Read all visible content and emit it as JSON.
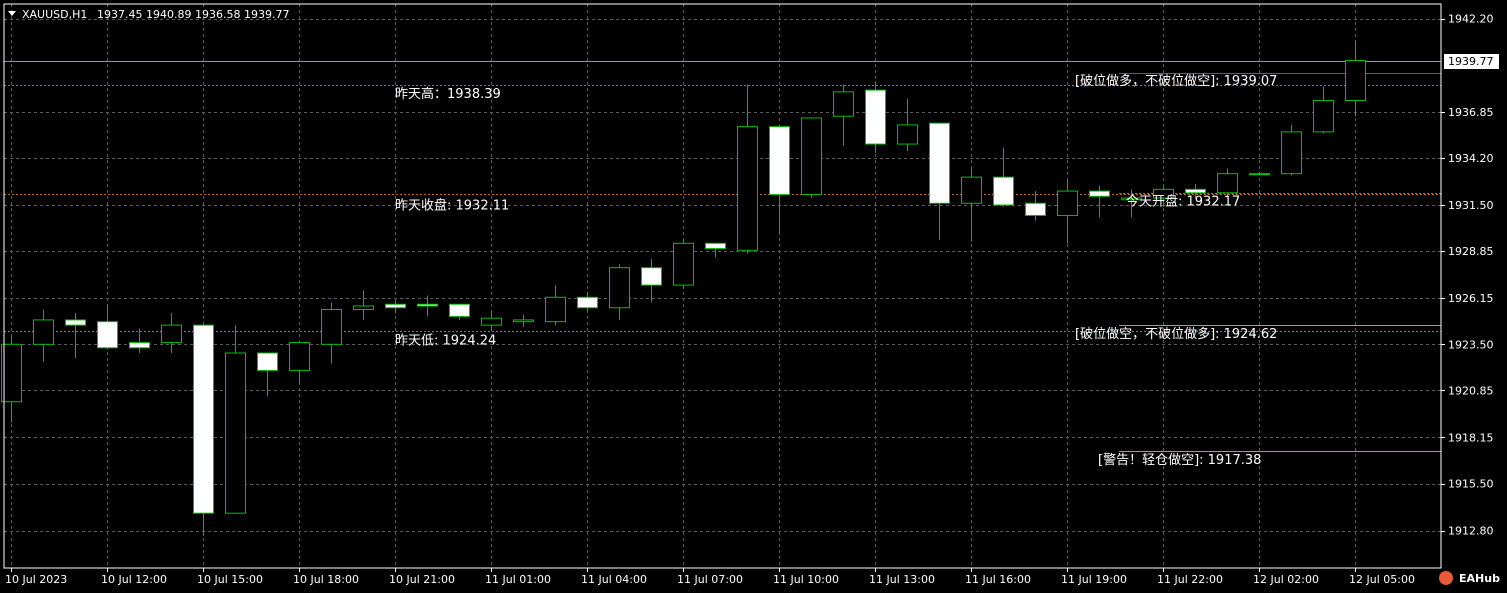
{
  "header": {
    "symbol": "XAUUSD,H1",
    "ohlc": "1937.45 1940.89 1936.58 1939.77"
  },
  "brand": {
    "label": "EAHub"
  },
  "colors": {
    "background": "#000000",
    "grid": "#5a5a5a",
    "candle_outline": "#00c000",
    "bull_body": "#000000",
    "bear_body": "#ffffff",
    "bid_line": "#8899aa",
    "level_red": "#c83232",
    "level_blue": "#8899cc",
    "level_dotted": "#b07030"
  },
  "chart_data": {
    "type": "candlestick",
    "timeframe": "H1",
    "ylim": [
      1911.8,
      1942.7
    ],
    "y_ticks": [
      "1942.20",
      "1939.77",
      "1936.85",
      "1934.20",
      "1931.50",
      "1928.85",
      "1926.15",
      "1923.50",
      "1920.85",
      "1918.15",
      "1915.50",
      "1912.80"
    ],
    "y_tick_values": [
      1942.2,
      1939.77,
      1936.85,
      1934.2,
      1931.5,
      1928.85,
      1926.15,
      1923.5,
      1920.85,
      1918.15,
      1915.5,
      1912.8
    ],
    "current_price": 1939.77,
    "x_ticks": [
      {
        "label": "10 Jul 2023",
        "index": 0
      },
      {
        "label": "10 Jul 12:00",
        "index": 3
      },
      {
        "label": "10 Jul 15:00",
        "index": 6
      },
      {
        "label": "10 Jul 18:00",
        "index": 9
      },
      {
        "label": "10 Jul 21:00",
        "index": 12
      },
      {
        "label": "11 Jul 01:00",
        "index": 15
      },
      {
        "label": "11 Jul 04:00",
        "index": 18
      },
      {
        "label": "11 Jul 07:00",
        "index": 21
      },
      {
        "label": "11 Jul 10:00",
        "index": 24
      },
      {
        "label": "11 Jul 13:00",
        "index": 27
      },
      {
        "label": "11 Jul 16:00",
        "index": 30
      },
      {
        "label": "11 Jul 19:00",
        "index": 33
      },
      {
        "label": "11 Jul 22:00",
        "index": 36
      },
      {
        "label": "12 Jul 02:00",
        "index": 39
      },
      {
        "label": "12 Jul 05:00",
        "index": 42
      }
    ],
    "candles": [
      {
        "o": 1920.2,
        "h": 1924.0,
        "l": 1919.0,
        "c": 1923.5
      },
      {
        "o": 1923.5,
        "h": 1925.5,
        "l": 1922.5,
        "c": 1924.9
      },
      {
        "o": 1924.9,
        "h": 1925.3,
        "l": 1922.7,
        "c": 1924.6
      },
      {
        "o": 1924.8,
        "h": 1925.8,
        "l": 1923.2,
        "c": 1923.3
      },
      {
        "o": 1923.6,
        "h": 1924.4,
        "l": 1923.0,
        "c": 1923.3
      },
      {
        "o": 1923.6,
        "h": 1925.3,
        "l": 1923.0,
        "c": 1924.6
      },
      {
        "o": 1924.6,
        "h": 1924.6,
        "l": 1912.5,
        "c": 1913.8
      },
      {
        "o": 1913.8,
        "h": 1924.6,
        "l": 1913.8,
        "c": 1923.0
      },
      {
        "o": 1923.0,
        "h": 1923.0,
        "l": 1920.5,
        "c": 1922.0
      },
      {
        "o": 1922.0,
        "h": 1923.6,
        "l": 1921.3,
        "c": 1923.6
      },
      {
        "o": 1923.5,
        "h": 1925.9,
        "l": 1922.4,
        "c": 1925.5
      },
      {
        "o": 1925.5,
        "h": 1926.6,
        "l": 1924.9,
        "c": 1925.7
      },
      {
        "o": 1925.8,
        "h": 1926.0,
        "l": 1925.3,
        "c": 1925.6
      },
      {
        "o": 1925.8,
        "h": 1926.3,
        "l": 1925.1,
        "c": 1925.7
      },
      {
        "o": 1925.8,
        "h": 1925.8,
        "l": 1924.9,
        "c": 1925.1
      },
      {
        "o": 1924.6,
        "h": 1925.4,
        "l": 1924.3,
        "c": 1925.0
      },
      {
        "o": 1924.8,
        "h": 1925.2,
        "l": 1924.5,
        "c": 1924.9
      },
      {
        "o": 1924.8,
        "h": 1926.9,
        "l": 1924.6,
        "c": 1926.2
      },
      {
        "o": 1926.2,
        "h": 1926.5,
        "l": 1925.4,
        "c": 1925.6
      },
      {
        "o": 1925.6,
        "h": 1928.1,
        "l": 1924.9,
        "c": 1927.9
      },
      {
        "o": 1927.9,
        "h": 1928.4,
        "l": 1925.9,
        "c": 1926.9
      },
      {
        "o": 1926.9,
        "h": 1929.5,
        "l": 1926.7,
        "c": 1929.3
      },
      {
        "o": 1929.3,
        "h": 1929.3,
        "l": 1928.5,
        "c": 1929.0
      },
      {
        "o": 1928.9,
        "h": 1938.4,
        "l": 1928.7,
        "c": 1936.0
      },
      {
        "o": 1936.0,
        "h": 1936.0,
        "l": 1929.9,
        "c": 1932.1
      },
      {
        "o": 1932.1,
        "h": 1936.5,
        "l": 1931.9,
        "c": 1936.5
      },
      {
        "o": 1936.6,
        "h": 1938.4,
        "l": 1934.9,
        "c": 1938.0
      },
      {
        "o": 1938.1,
        "h": 1938.6,
        "l": 1934.5,
        "c": 1935.0
      },
      {
        "o": 1935.0,
        "h": 1937.6,
        "l": 1934.6,
        "c": 1936.1
      },
      {
        "o": 1936.2,
        "h": 1936.2,
        "l": 1929.5,
        "c": 1931.6
      },
      {
        "o": 1931.6,
        "h": 1933.6,
        "l": 1929.4,
        "c": 1933.1
      },
      {
        "o": 1933.1,
        "h": 1934.8,
        "l": 1931.4,
        "c": 1931.5
      },
      {
        "o": 1931.6,
        "h": 1932.3,
        "l": 1930.6,
        "c": 1930.9
      },
      {
        "o": 1930.9,
        "h": 1933.0,
        "l": 1929.3,
        "c": 1932.3
      },
      {
        "o": 1932.3,
        "h": 1932.6,
        "l": 1930.8,
        "c": 1932.0
      },
      {
        "o": 1931.8,
        "h": 1932.4,
        "l": 1930.8,
        "c": 1931.9
      },
      {
        "o": 1931.9,
        "h": 1932.6,
        "l": 1931.4,
        "c": 1932.4
      },
      {
        "o": 1932.4,
        "h": 1932.7,
        "l": 1931.9,
        "c": 1932.2
      },
      {
        "o": 1932.2,
        "h": 1933.6,
        "l": 1932.0,
        "c": 1933.3
      },
      {
        "o": 1933.3,
        "h": 1933.4,
        "l": 1933.2,
        "c": 1933.3
      },
      {
        "o": 1933.3,
        "h": 1936.1,
        "l": 1933.2,
        "c": 1935.7
      },
      {
        "o": 1935.7,
        "h": 1938.3,
        "l": 1935.6,
        "c": 1937.5
      },
      {
        "o": 1937.5,
        "h": 1940.9,
        "l": 1936.6,
        "c": 1939.8
      }
    ],
    "levels": [
      {
        "name": "breakout-long-level",
        "label": "[破位做多，不破位做空]: 1939.07",
        "value": 1939.07,
        "style": "solid",
        "color": "#c83232",
        "x_start_index": 35
      },
      {
        "name": "yesterday-high-level",
        "label": "昨天高：1938.39",
        "value": 1938.39,
        "style": "dotted",
        "color": "#b07030",
        "x_start_index": 0
      },
      {
        "name": "today-open-level",
        "label": "今天开盘: 1932.17",
        "value": 1932.17,
        "style": "dotted",
        "color": "#b07030",
        "x_start_index": 35
      },
      {
        "name": "yesterday-close-level",
        "label": "昨天收盘: 1932.11",
        "value": 1932.11,
        "style": "dotted",
        "color": "#b07030",
        "x_start_index": 0
      },
      {
        "name": "breakout-short-level",
        "label": "[破位做空，不破位做多]: 1924.62",
        "value": 1924.62,
        "style": "solid",
        "color": "#8899cc",
        "x_start_index": 35
      },
      {
        "name": "yesterday-low-level",
        "label": "昨天低: 1924.24",
        "value": 1924.24,
        "style": "dotted",
        "color": "#b07030",
        "x_start_index": 0
      },
      {
        "name": "warning-short-level",
        "label": "[警告！轻仓做空]: 1917.38",
        "value": 1917.38,
        "style": "solid",
        "color": "#8899cc",
        "x_start_index": 35
      }
    ],
    "grid": true
  }
}
